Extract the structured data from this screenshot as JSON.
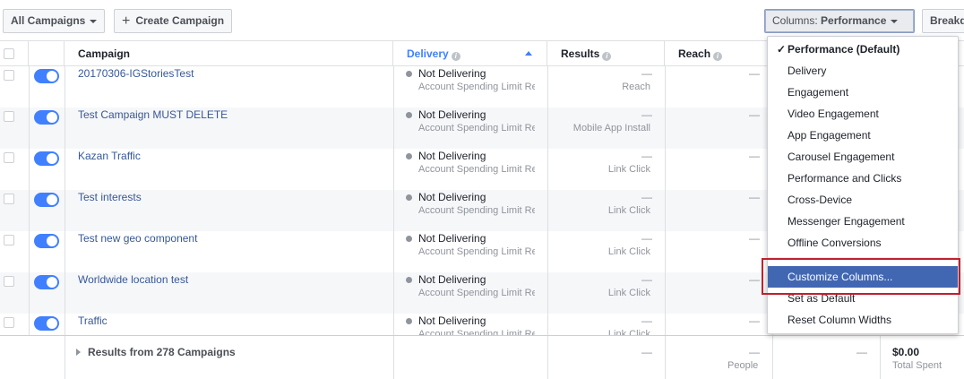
{
  "toolbar": {
    "all_campaigns": "All Campaigns",
    "create_campaign": "Create Campaign",
    "columns_prefix": "Columns: ",
    "columns_value": "Performance",
    "breakdown": "Breakdown"
  },
  "table": {
    "headers": {
      "campaign": "Campaign",
      "delivery": "Delivery",
      "results": "Results",
      "reach": "Reach"
    },
    "rows": [
      {
        "name": "20170306-IGStoriesTest",
        "delivery": "Not Delivering",
        "delivery_sub": "Account Spending Limit Reached",
        "result": "—",
        "result_sub": "Reach",
        "reach": "—"
      },
      {
        "name": "Test Campaign MUST DELETE",
        "delivery": "Not Delivering",
        "delivery_sub": "Account Spending Limit Reached",
        "result": "—",
        "result_sub": "Mobile App Install",
        "reach": "—"
      },
      {
        "name": "Kazan Traffic",
        "delivery": "Not Delivering",
        "delivery_sub": "Account Spending Limit Reached",
        "result": "—",
        "result_sub": "Link Click",
        "reach": "—"
      },
      {
        "name": "Test interests",
        "delivery": "Not Delivering",
        "delivery_sub": "Account Spending Limit Reached",
        "result": "—",
        "result_sub": "Link Click",
        "reach": "—"
      },
      {
        "name": "Test new geo component",
        "delivery": "Not Delivering",
        "delivery_sub": "Account Spending Limit Reached",
        "result": "—",
        "result_sub": "Link Click",
        "reach": "—"
      },
      {
        "name": "Worldwide location test",
        "delivery": "Not Delivering",
        "delivery_sub": "Account Spending Limit Reached",
        "result": "—",
        "result_sub": "Link Click",
        "reach": "—"
      },
      {
        "name": "Traffic",
        "delivery": "Not Delivering",
        "delivery_sub": "Account Spending Limit Reached",
        "result": "—",
        "result_sub": "Link Click",
        "reach": "—"
      }
    ],
    "footer": {
      "label": "Results from 278 Campaigns",
      "results": "—",
      "reach": "—",
      "reach_sub": "People",
      "col5": "—",
      "spent": "$0.00",
      "spent_sub": "Total Spent"
    }
  },
  "columns_menu": {
    "items": [
      {
        "label": "Performance (Default)",
        "checked": true
      },
      {
        "label": "Delivery"
      },
      {
        "label": "Engagement"
      },
      {
        "label": "Video Engagement"
      },
      {
        "label": "App Engagement"
      },
      {
        "label": "Carousel Engagement"
      },
      {
        "label": "Performance and Clicks"
      },
      {
        "label": "Cross-Device"
      },
      {
        "label": "Messenger Engagement"
      },
      {
        "label": "Offline Conversions"
      }
    ],
    "customize": "Customize Columns...",
    "set_default": "Set as Default",
    "reset_widths": "Reset Column Widths"
  },
  "colors": {
    "accent": "#4080ff",
    "link": "#365899",
    "highlight": "#4267b2",
    "annotation": "#c0202e"
  }
}
